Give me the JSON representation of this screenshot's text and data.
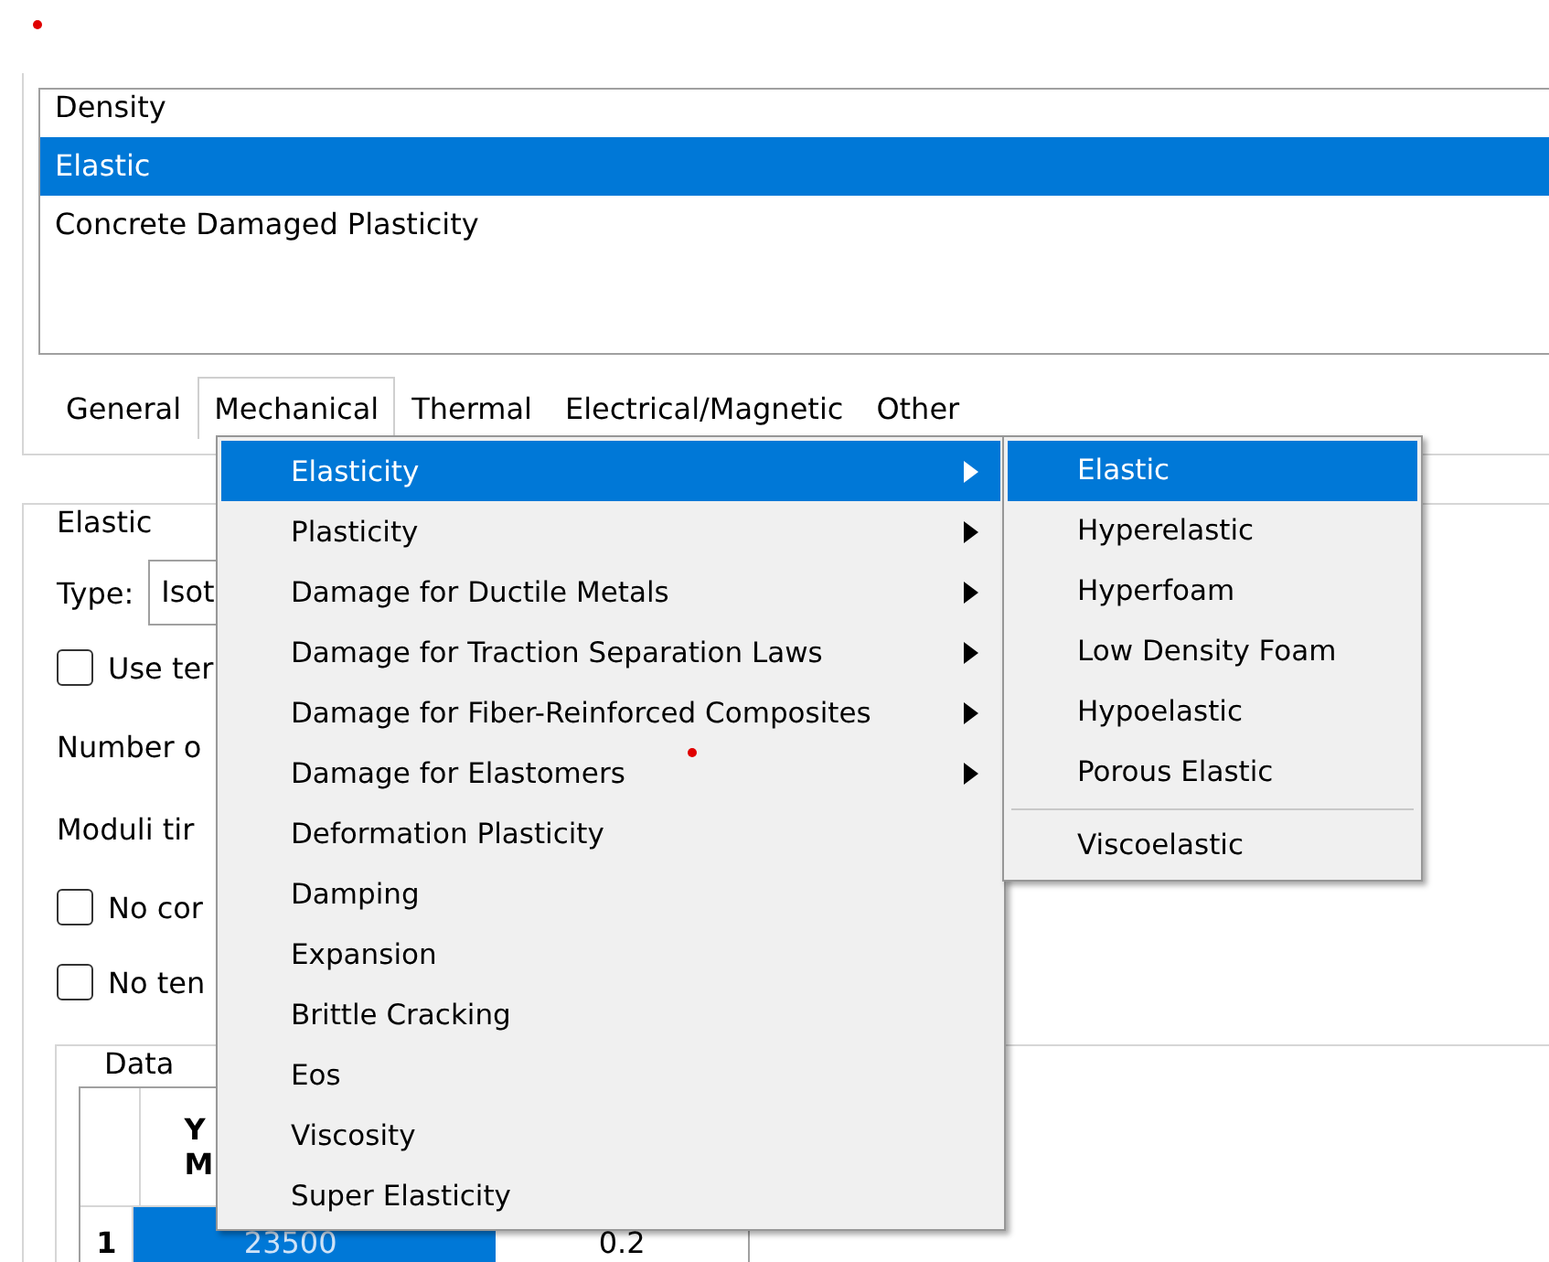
{
  "material_list": {
    "items": [
      {
        "label": "Density",
        "selected": false
      },
      {
        "label": "Elastic",
        "selected": true
      },
      {
        "label": "Concrete Damaged Plasticity",
        "selected": false
      }
    ]
  },
  "tabs": [
    {
      "label": "General",
      "selected": false
    },
    {
      "label": "Mechanical",
      "selected": true
    },
    {
      "label": "Thermal",
      "selected": false
    },
    {
      "label": "Electrical/Magnetic",
      "selected": false
    },
    {
      "label": "Other",
      "selected": false
    }
  ],
  "elastic_section": {
    "title": "Elastic",
    "type_label": "Type:",
    "type_value": "Isot",
    "options": [
      {
        "kind": "checkbox",
        "label": "Use ter",
        "checked": false
      },
      {
        "kind": "text",
        "label": "Number o"
      },
      {
        "kind": "text",
        "label": "Moduli tir"
      },
      {
        "kind": "checkbox",
        "label": "No cor",
        "checked": false
      },
      {
        "kind": "checkbox",
        "label": "No ten",
        "checked": false
      }
    ]
  },
  "data_section": {
    "title": "Data",
    "column_1_header": [
      "Y",
      "M"
    ],
    "rows": [
      {
        "index": "1",
        "cells": [
          {
            "value": "23500",
            "selected": true
          },
          {
            "value": "0.2",
            "selected": false
          }
        ]
      }
    ]
  },
  "menu": {
    "items": [
      {
        "label": "Elasticity",
        "has_submenu": true,
        "selected": true
      },
      {
        "label": "Plasticity",
        "has_submenu": true,
        "selected": false
      },
      {
        "label": "Damage for Ductile Metals",
        "has_submenu": true,
        "selected": false
      },
      {
        "label": "Damage for Traction Separation Laws",
        "has_submenu": true,
        "selected": false
      },
      {
        "label": "Damage for Fiber-Reinforced Composites",
        "has_submenu": true,
        "selected": false
      },
      {
        "label": "Damage for Elastomers",
        "has_submenu": true,
        "selected": false
      },
      {
        "label": "Deformation Plasticity",
        "has_submenu": false,
        "selected": false
      },
      {
        "label": "Damping",
        "has_submenu": false,
        "selected": false
      },
      {
        "label": "Expansion",
        "has_submenu": false,
        "selected": false
      },
      {
        "label": "Brittle Cracking",
        "has_submenu": false,
        "selected": false
      },
      {
        "label": "Eos",
        "has_submenu": false,
        "selected": false
      },
      {
        "label": "Viscosity",
        "has_submenu": false,
        "selected": false
      },
      {
        "label": "Super Elasticity",
        "has_submenu": false,
        "selected": false
      }
    ]
  },
  "submenu": {
    "items": [
      {
        "kind": "item",
        "label": "Elastic",
        "selected": true
      },
      {
        "kind": "item",
        "label": "Hyperelastic",
        "selected": false
      },
      {
        "kind": "item",
        "label": "Hyperfoam",
        "selected": false
      },
      {
        "kind": "item",
        "label": "Low Density Foam",
        "selected": false
      },
      {
        "kind": "item",
        "label": "Hypoelastic",
        "selected": false
      },
      {
        "kind": "item",
        "label": "Porous Elastic",
        "selected": false
      },
      {
        "kind": "separator"
      },
      {
        "kind": "item",
        "label": "Viscoelastic",
        "selected": false
      }
    ]
  }
}
